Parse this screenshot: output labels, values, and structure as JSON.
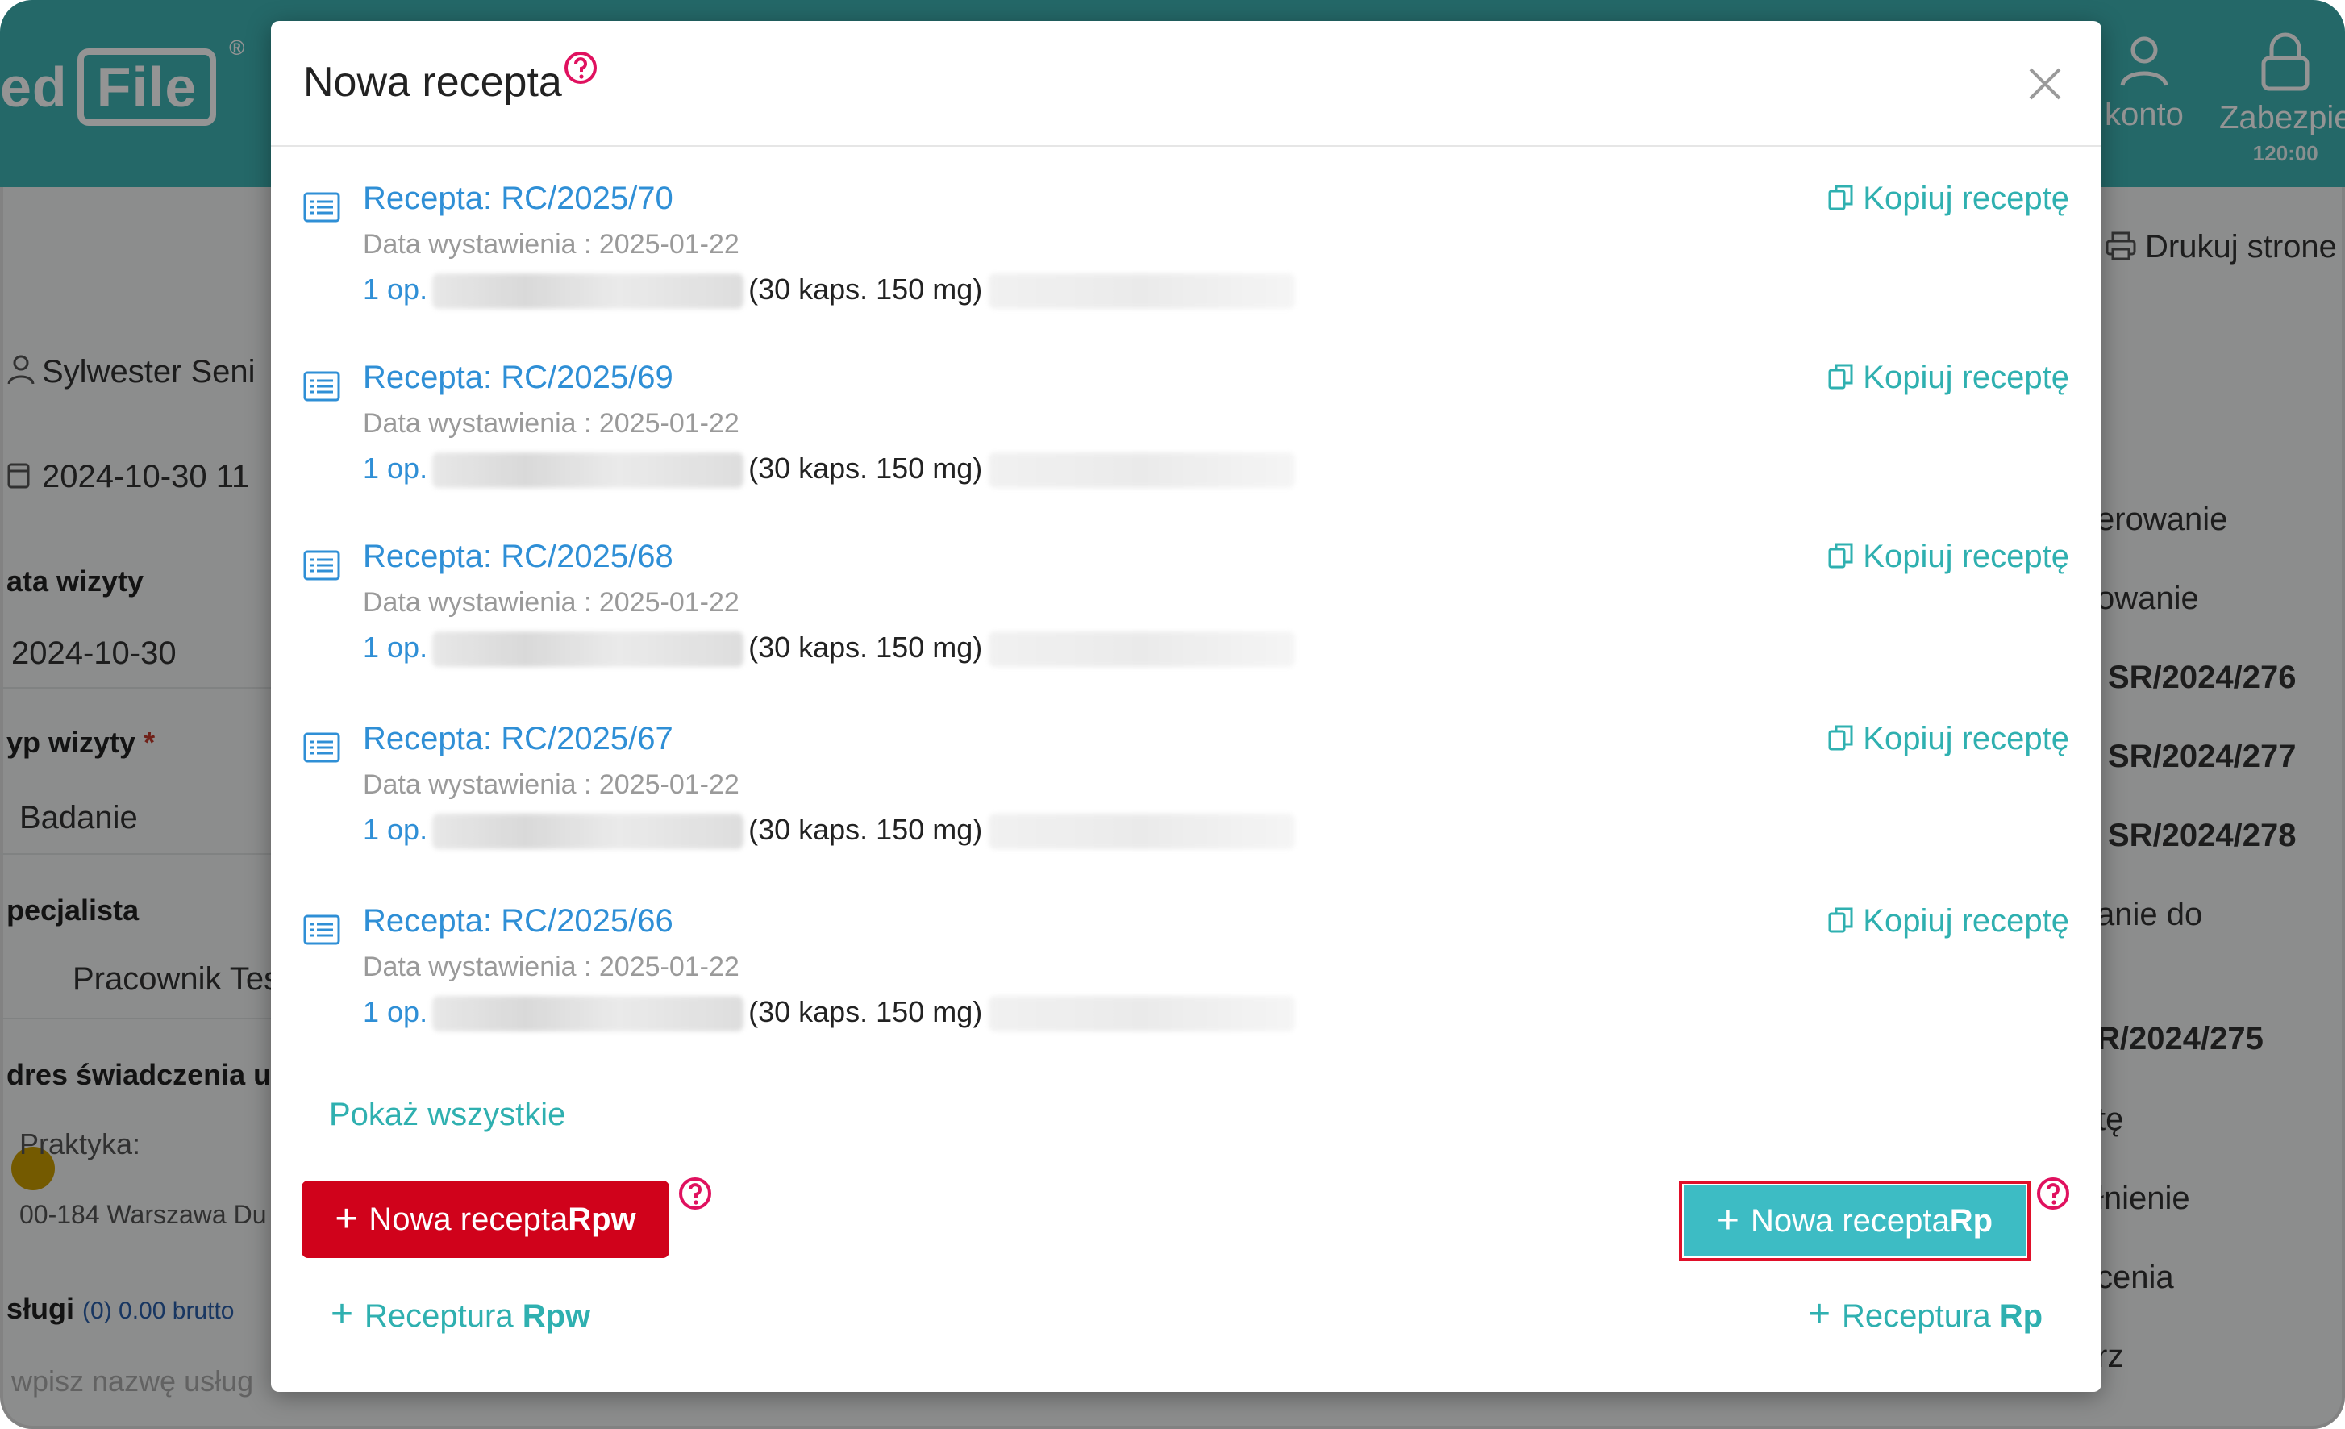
{
  "app": {
    "logo_left": "ed",
    "logo_file": "File",
    "logo_reg": "®",
    "top_items": [
      {
        "label": "konto"
      },
      {
        "label": "Zabezpie",
        "timer": "120:00"
      }
    ],
    "print_label": "Drukuj strone",
    "left_panel": {
      "patient": "Sylwester Seni",
      "visit_datetime": "2024-10-30 11",
      "visit_date_label": "ata wizyty",
      "visit_date": "2024-10-30",
      "visit_type_label": "yp wizyty",
      "visit_type": "Badanie",
      "specialist_label": "pecjalista",
      "specialist": "Pracownik Tes",
      "address_label": "dres świadczenia us",
      "practice": "Praktyka:",
      "address": "00-184 Warszawa Du",
      "services_label": "sługi",
      "services_value": "(0) 0.00 brutto",
      "services_placeholder": "wpisz nazwę usług"
    },
    "right_panel": [
      {
        "text": "erowanie",
        "bold": false
      },
      {
        "text": "owanie",
        "bold": false
      },
      {
        "text": "SR/2024/276",
        "bold": true
      },
      {
        "text": "SR/2024/277",
        "bold": true
      },
      {
        "text": "SR/2024/278",
        "bold": true
      },
      {
        "text": "anie do",
        "bold": false
      },
      {
        "text": "R/2024/275",
        "bold": true
      },
      {
        "text": "tę",
        "bold": false
      },
      {
        "text": "łnienie",
        "bold": false
      },
      {
        "text": "cenia",
        "bold": false
      },
      {
        "text": "rz",
        "bold": false
      }
    ]
  },
  "modal": {
    "title": "Nowa recepta",
    "help_icon": "question-circle-icon",
    "close_icon": "close-icon",
    "prescriptions": [
      {
        "title": "Recepta: RC/2025/70",
        "date_label": "Data wystawienia : 2025-01-22",
        "qty": "1 op.",
        "dose": "(30 kaps. 150 mg)",
        "copy_label": "Kopiuj receptę"
      },
      {
        "title": "Recepta: RC/2025/69",
        "date_label": "Data wystawienia : 2025-01-22",
        "qty": "1 op.",
        "dose": "(30 kaps. 150 mg)",
        "copy_label": "Kopiuj receptę"
      },
      {
        "title": "Recepta: RC/2025/68",
        "date_label": "Data wystawienia : 2025-01-22",
        "qty": "1 op.",
        "dose": "(30 kaps. 150 mg)",
        "copy_label": "Kopiuj receptę"
      },
      {
        "title": "Recepta: RC/2025/67",
        "date_label": "Data wystawienia : 2025-01-22",
        "qty": "1 op.",
        "dose": "(30 kaps. 150 mg)",
        "copy_label": "Kopiuj receptę"
      },
      {
        "title": "Recepta: RC/2025/66",
        "date_label": "Data wystawienia : 2025-01-22",
        "qty": "1 op.",
        "dose": "(30 kaps. 150 mg)",
        "copy_label": "Kopiuj receptę"
      }
    ],
    "show_all": "Pokaż wszystkie",
    "new_rpw": {
      "prefix": "Nowa recepta ",
      "suffix": "Rpw"
    },
    "new_rp": {
      "prefix": "Nowa recepta ",
      "suffix": "Rp"
    },
    "receptura_rpw": {
      "prefix": "Receptura ",
      "suffix": "Rpw"
    },
    "receptura_rp": {
      "prefix": "Receptura ",
      "suffix": "Rp"
    }
  },
  "colors": {
    "brand_teal": "#3fb3b3",
    "link_blue": "#2f8fd6",
    "danger_red": "#d0021b",
    "rp_button": "#3dbcc4",
    "help_pink": "#e0115f"
  }
}
